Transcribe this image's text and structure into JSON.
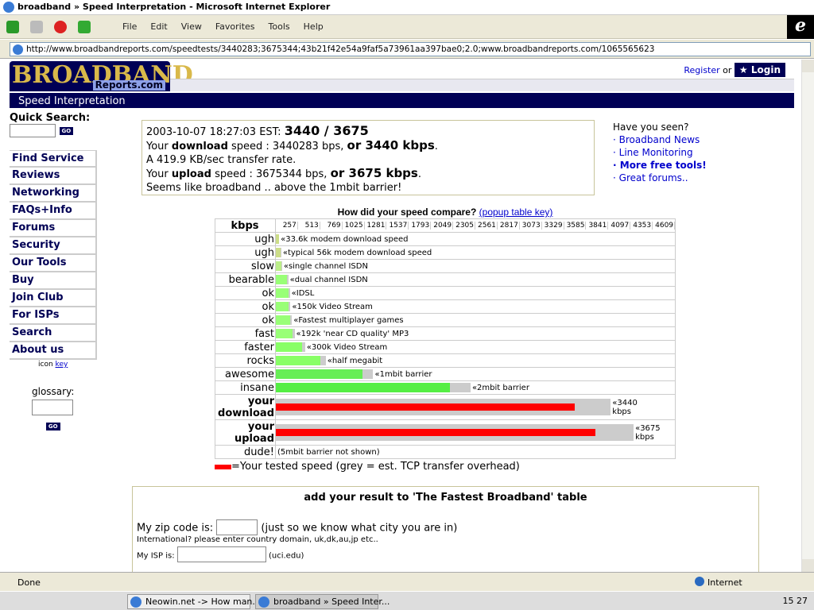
{
  "window": {
    "title": "broadband » Speed Interpretation - Microsoft Internet Explorer"
  },
  "menu": [
    "File",
    "Edit",
    "View",
    "Favorites",
    "Tools",
    "Help"
  ],
  "address": "http://www.broadbandreports.com/speedtests/3440283;3675344;43b21f42e54a9faf5a73961aa397bae0;2.0;www.broadbandreports.com/1065565623",
  "site": {
    "logo": "BROADBAND",
    "logo_sub": "Reports.com",
    "section": "Speed Interpretation",
    "register": "Register",
    "or": "or",
    "login": "Login"
  },
  "quick_search": {
    "label": "Quick Search:",
    "go": "GO"
  },
  "sidebar": [
    "Find Service",
    "Reviews",
    "Networking",
    "FAQs+Info",
    "Forums",
    "Security",
    "Our Tools",
    "Buy",
    "Join Club",
    "For ISPs",
    "Search",
    "About us"
  ],
  "icon_key": {
    "prefix": "icon",
    "link": "key"
  },
  "glossary": {
    "label": "glossary:",
    "go": "GO"
  },
  "result": {
    "date": "2003-10-07 18:27:03 EST:",
    "headline": "3440 / 3675",
    "dl_pre": "Your",
    "dl_word": "download",
    "dl_mid": "speed : 3440283 bps,",
    "dl_big": "or 3440 kbps",
    "rate": "A 419.9 KB/sec transfer rate.",
    "ul_pre": "Your",
    "ul_word": "upload",
    "ul_mid": "speed : 3675344 bps,",
    "ul_big": "or 3675 kbps",
    "verdict": "Seems like broadband .. above the 1mbit barrier!"
  },
  "have_seen": {
    "title": "Have you seen?",
    "links": [
      "Broadband News",
      "Line Monitoring",
      "More free tools!",
      "Great forums.."
    ]
  },
  "chart_data": {
    "type": "bar",
    "title": "How did your speed compare?",
    "title_link": "(popup table key)",
    "xlabel": "kbps",
    "ticks": [
      257,
      513,
      769,
      1025,
      1281,
      1537,
      1793,
      2049,
      2305,
      2561,
      2817,
      3073,
      3329,
      3585,
      3841,
      4097,
      4353,
      4609
    ],
    "xlim": [
      0,
      4609
    ],
    "overhead_factor": 1.12,
    "rows": [
      {
        "label": "ugh",
        "kbps": 33.6,
        "note": "«33.6k modem download speed",
        "color": "#ccdd88"
      },
      {
        "label": "ugh",
        "kbps": 56,
        "note": "«typical 56k modem download speed",
        "color": "#ccdd88"
      },
      {
        "label": "slow",
        "kbps": 64,
        "note": "«single channel ISDN",
        "color": "#bbee88"
      },
      {
        "label": "bearable",
        "kbps": 128,
        "note": "«dual channel ISDN",
        "color": "#99ff77"
      },
      {
        "label": "ok",
        "kbps": 144,
        "note": "«IDSL",
        "color": "#99ff77"
      },
      {
        "label": "ok",
        "kbps": 150,
        "note": "«150k Video Stream",
        "color": "#99ff77"
      },
      {
        "label": "ok",
        "kbps": 165,
        "note": "«Fastest multiplayer games",
        "color": "#99ff77"
      },
      {
        "label": "fast",
        "kbps": 192,
        "note": "«192k 'near CD quality' MP3",
        "color": "#99ff77"
      },
      {
        "label": "faster",
        "kbps": 300,
        "note": "«300k Video Stream",
        "color": "#88ff66"
      },
      {
        "label": "rocks",
        "kbps": 512,
        "note": "«half megabit",
        "color": "#88ff66"
      },
      {
        "label": "awesome",
        "kbps": 1000,
        "note": "«1mbit barrier",
        "color": "#66ee55"
      },
      {
        "label": "insane",
        "kbps": 2000,
        "note": "«2mbit barrier",
        "color": "#55ee44"
      },
      {
        "label": "your download",
        "kbps": 3440,
        "note": "«3440 kbps",
        "color": "#ff0000",
        "bold": true
      },
      {
        "label": "your upload",
        "kbps": 3675,
        "note": "«3675 kbps",
        "color": "#ff0000",
        "bold": true
      },
      {
        "label": "dude!",
        "kbps": 0,
        "note": "(5mbit barrier not shown)",
        "color": "#ffffff"
      }
    ],
    "legend": "=Your tested speed (grey = est. TCP transfer overhead)"
  },
  "add": {
    "title": "add your result to 'The Fastest Broadband' table",
    "zip_label": "My zip code is:",
    "zip_hint": "(just so we know what city you are in)",
    "intl": "International? please enter country domain, uk,dk,au,jp etc..",
    "isp_label": "My ISP is:",
    "isp_hint": "(uci.edu)"
  },
  "status": {
    "left": "Done",
    "zone": "Internet"
  },
  "taskbar": {
    "items": [
      "Neowin.net -> How man...",
      "broadband » Speed Inter..."
    ],
    "clock": "15 27"
  }
}
